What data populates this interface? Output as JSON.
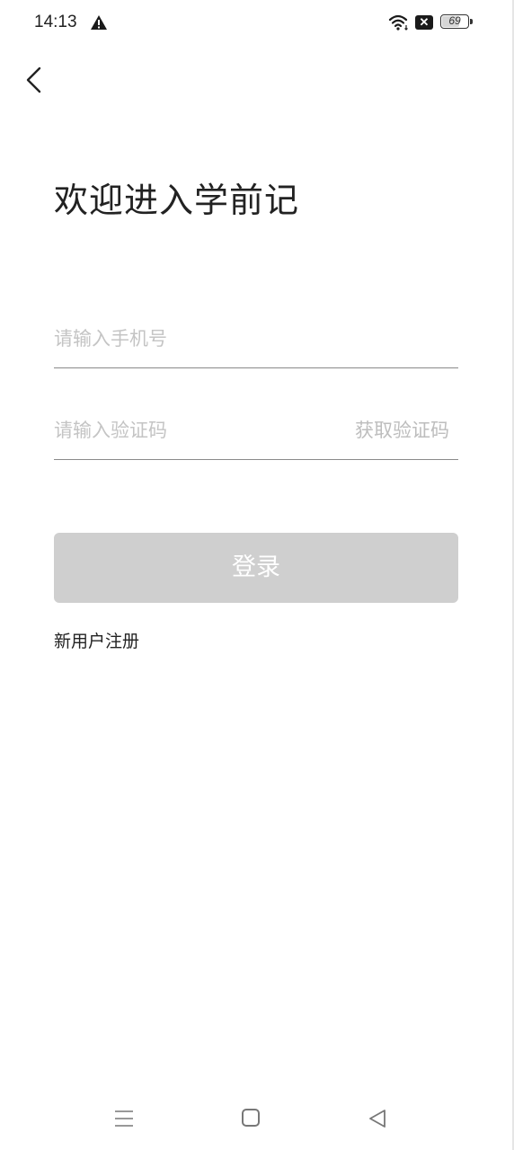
{
  "status_bar": {
    "time": "14:13",
    "battery_level": "69",
    "battery_fraction": 0.69,
    "sim_icon_text": "✕",
    "icons": [
      "warning-icon",
      "wifi-icon",
      "sim-error-icon",
      "battery-icon"
    ]
  },
  "header": {
    "back_icon": "chevron-left-icon"
  },
  "title": "欢迎进入学前记",
  "form": {
    "phone_placeholder": "请输入手机号",
    "phone_value": "",
    "code_placeholder": "请输入验证码",
    "code_value": "",
    "get_code_label": "获取验证码",
    "login_label": "登录",
    "register_label": "新用户注册"
  },
  "nav_bar": {
    "icons": [
      "menu-icon",
      "home-icon",
      "back-triangle-icon"
    ]
  },
  "colors": {
    "login_button_disabled": "#cfcfcf",
    "placeholder": "#c4c4c4",
    "text": "#222222",
    "divider": "#8a8a8a"
  }
}
